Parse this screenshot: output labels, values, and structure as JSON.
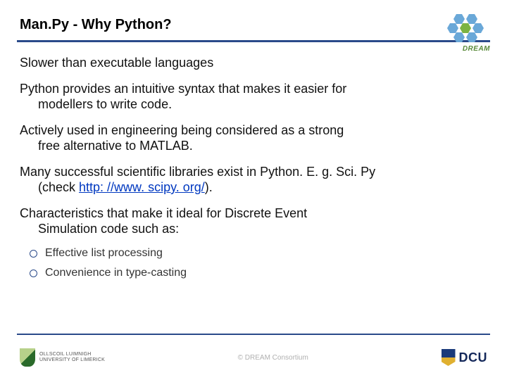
{
  "header": {
    "title": "Man.Py - Why Python?",
    "logo_label": "DREAM"
  },
  "content": {
    "p1": "Slower than executable languages",
    "p2a": "Python provides an intuitive syntax that makes it easier for",
    "p2b": "modellers to write code.",
    "p3a": "Actively used in engineering being considered as a strong",
    "p3b": "free alternative to MATLAB.",
    "p4a": "Many successful scientific libraries exist in Python. E. g. Sci. Py",
    "p4b_pre": "(check ",
    "p4b_link": "http: //www. scipy. org/",
    "p4b_post": ").",
    "p5a": "Characteristics that make it ideal for Discrete Event",
    "p5b": "Simulation code such as:",
    "bullets": [
      "Effective list processing",
      "Convenience in type-casting"
    ]
  },
  "footer": {
    "ul_line1": "Ollscoil Luimnigh",
    "ul_line2": "University of Limerick",
    "copyright": "© DREAM Consortium",
    "dcu": "DCU"
  }
}
